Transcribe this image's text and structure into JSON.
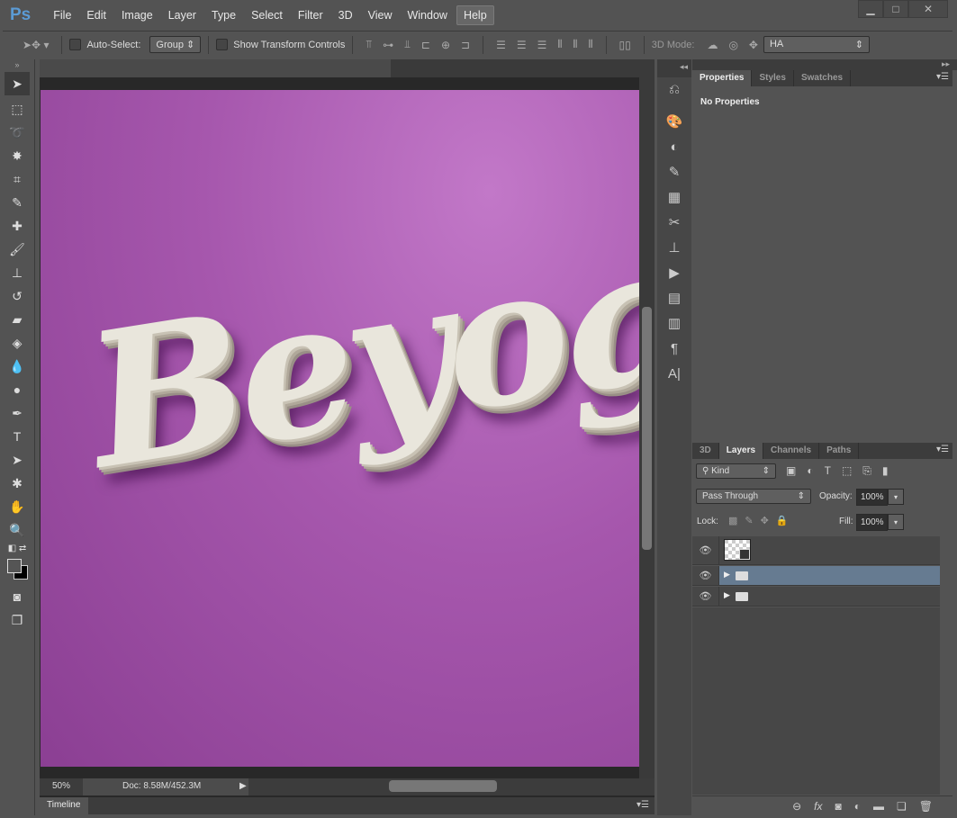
{
  "app": {
    "logo": "Ps"
  },
  "menu": [
    "File",
    "Edit",
    "Image",
    "Layer",
    "Type",
    "Select",
    "Filter",
    "3D",
    "View",
    "Window",
    "Help"
  ],
  "window_controls": {
    "minimize": "▁",
    "maximize": "□",
    "close": "✕"
  },
  "options": {
    "auto_select_label": "Auto-Select:",
    "auto_select_checked": false,
    "auto_select_mode": "Group",
    "show_transform_label": "Show Transform Controls",
    "show_transform_checked": false,
    "mode_3d_label": "3D Mode:",
    "workspace": "HA"
  },
  "canvas": {
    "artwork_text": "Beyoglub",
    "background_color": "#a95cb0"
  },
  "status": {
    "zoom": "50%",
    "doc": "Doc: 8.58M/452.3M"
  },
  "timeline": {
    "tab": "Timeline"
  },
  "properties": {
    "tabs": [
      "Properties",
      "Styles",
      "Swatches"
    ],
    "active_tab": "Properties",
    "content": "No Properties"
  },
  "layers": {
    "tabs": [
      "3D",
      "Layers",
      "Channels",
      "Paths"
    ],
    "active_tab": "Layers",
    "filter": "Kind",
    "blend_mode": "Pass Through",
    "opacity_label": "Opacity:",
    "opacity": "100%",
    "lock_label": "Lock:",
    "fill_label": "Fill:",
    "fill": "100%",
    "rows": [
      {
        "type": "smart-object",
        "visible": true,
        "selected": false
      },
      {
        "type": "group",
        "visible": true,
        "selected": true
      },
      {
        "type": "group",
        "visible": true,
        "selected": false
      }
    ],
    "selected_color": "#667b91"
  }
}
